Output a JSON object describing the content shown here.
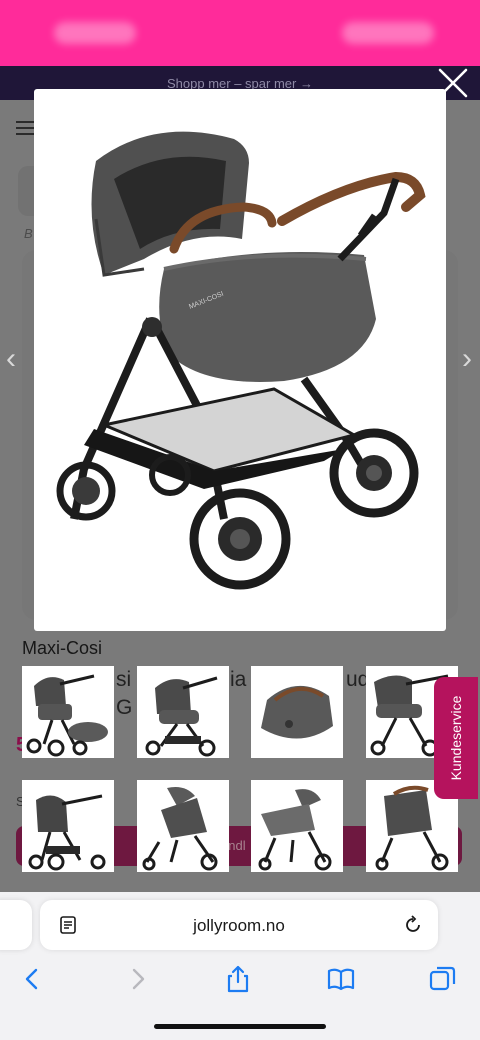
{
  "promo": {
    "text": "Shopp mer – spar mer →"
  },
  "product": {
    "brand": "Maxi-Cosi",
    "title_fragments": [
      "si",
      "ia",
      "ud",
      "G"
    ],
    "price_fragment": "5",
    "stock_fragment": "S",
    "cart_fragment": "andl"
  },
  "support": {
    "label": "Kundeservice"
  },
  "browser": {
    "url": "jollyroom.no"
  },
  "colors": {
    "accent": "#b5135d",
    "header_pink": "#ff2b9a",
    "promo_bar": "#1f1638"
  },
  "icons": {
    "close": "close-icon",
    "reader": "reader-mode-icon",
    "reload": "reload-icon",
    "back": "back-icon",
    "forward": "forward-icon",
    "share": "share-icon",
    "bookmarks": "bookmarks-icon",
    "tabs": "tabs-icon"
  }
}
